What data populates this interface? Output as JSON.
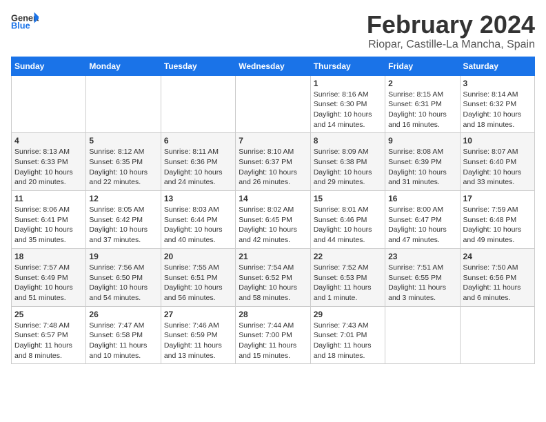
{
  "header": {
    "logo_general": "General",
    "logo_blue": "Blue",
    "title": "February 2024",
    "subtitle": "Riopar, Castille-La Mancha, Spain"
  },
  "days_of_week": [
    "Sunday",
    "Monday",
    "Tuesday",
    "Wednesday",
    "Thursday",
    "Friday",
    "Saturday"
  ],
  "weeks": [
    [
      {
        "num": "",
        "info": ""
      },
      {
        "num": "",
        "info": ""
      },
      {
        "num": "",
        "info": ""
      },
      {
        "num": "",
        "info": ""
      },
      {
        "num": "1",
        "info": "Sunrise: 8:16 AM\nSunset: 6:30 PM\nDaylight: 10 hours\nand 14 minutes."
      },
      {
        "num": "2",
        "info": "Sunrise: 8:15 AM\nSunset: 6:31 PM\nDaylight: 10 hours\nand 16 minutes."
      },
      {
        "num": "3",
        "info": "Sunrise: 8:14 AM\nSunset: 6:32 PM\nDaylight: 10 hours\nand 18 minutes."
      }
    ],
    [
      {
        "num": "4",
        "info": "Sunrise: 8:13 AM\nSunset: 6:33 PM\nDaylight: 10 hours\nand 20 minutes."
      },
      {
        "num": "5",
        "info": "Sunrise: 8:12 AM\nSunset: 6:35 PM\nDaylight: 10 hours\nand 22 minutes."
      },
      {
        "num": "6",
        "info": "Sunrise: 8:11 AM\nSunset: 6:36 PM\nDaylight: 10 hours\nand 24 minutes."
      },
      {
        "num": "7",
        "info": "Sunrise: 8:10 AM\nSunset: 6:37 PM\nDaylight: 10 hours\nand 26 minutes."
      },
      {
        "num": "8",
        "info": "Sunrise: 8:09 AM\nSunset: 6:38 PM\nDaylight: 10 hours\nand 29 minutes."
      },
      {
        "num": "9",
        "info": "Sunrise: 8:08 AM\nSunset: 6:39 PM\nDaylight: 10 hours\nand 31 minutes."
      },
      {
        "num": "10",
        "info": "Sunrise: 8:07 AM\nSunset: 6:40 PM\nDaylight: 10 hours\nand 33 minutes."
      }
    ],
    [
      {
        "num": "11",
        "info": "Sunrise: 8:06 AM\nSunset: 6:41 PM\nDaylight: 10 hours\nand 35 minutes."
      },
      {
        "num": "12",
        "info": "Sunrise: 8:05 AM\nSunset: 6:42 PM\nDaylight: 10 hours\nand 37 minutes."
      },
      {
        "num": "13",
        "info": "Sunrise: 8:03 AM\nSunset: 6:44 PM\nDaylight: 10 hours\nand 40 minutes."
      },
      {
        "num": "14",
        "info": "Sunrise: 8:02 AM\nSunset: 6:45 PM\nDaylight: 10 hours\nand 42 minutes."
      },
      {
        "num": "15",
        "info": "Sunrise: 8:01 AM\nSunset: 6:46 PM\nDaylight: 10 hours\nand 44 minutes."
      },
      {
        "num": "16",
        "info": "Sunrise: 8:00 AM\nSunset: 6:47 PM\nDaylight: 10 hours\nand 47 minutes."
      },
      {
        "num": "17",
        "info": "Sunrise: 7:59 AM\nSunset: 6:48 PM\nDaylight: 10 hours\nand 49 minutes."
      }
    ],
    [
      {
        "num": "18",
        "info": "Sunrise: 7:57 AM\nSunset: 6:49 PM\nDaylight: 10 hours\nand 51 minutes."
      },
      {
        "num": "19",
        "info": "Sunrise: 7:56 AM\nSunset: 6:50 PM\nDaylight: 10 hours\nand 54 minutes."
      },
      {
        "num": "20",
        "info": "Sunrise: 7:55 AM\nSunset: 6:51 PM\nDaylight: 10 hours\nand 56 minutes."
      },
      {
        "num": "21",
        "info": "Sunrise: 7:54 AM\nSunset: 6:52 PM\nDaylight: 10 hours\nand 58 minutes."
      },
      {
        "num": "22",
        "info": "Sunrise: 7:52 AM\nSunset: 6:53 PM\nDaylight: 11 hours\nand 1 minute."
      },
      {
        "num": "23",
        "info": "Sunrise: 7:51 AM\nSunset: 6:55 PM\nDaylight: 11 hours\nand 3 minutes."
      },
      {
        "num": "24",
        "info": "Sunrise: 7:50 AM\nSunset: 6:56 PM\nDaylight: 11 hours\nand 6 minutes."
      }
    ],
    [
      {
        "num": "25",
        "info": "Sunrise: 7:48 AM\nSunset: 6:57 PM\nDaylight: 11 hours\nand 8 minutes."
      },
      {
        "num": "26",
        "info": "Sunrise: 7:47 AM\nSunset: 6:58 PM\nDaylight: 11 hours\nand 10 minutes."
      },
      {
        "num": "27",
        "info": "Sunrise: 7:46 AM\nSunset: 6:59 PM\nDaylight: 11 hours\nand 13 minutes."
      },
      {
        "num": "28",
        "info": "Sunrise: 7:44 AM\nSunset: 7:00 PM\nDaylight: 11 hours\nand 15 minutes."
      },
      {
        "num": "29",
        "info": "Sunrise: 7:43 AM\nSunset: 7:01 PM\nDaylight: 11 hours\nand 18 minutes."
      },
      {
        "num": "",
        "info": ""
      },
      {
        "num": "",
        "info": ""
      }
    ]
  ]
}
